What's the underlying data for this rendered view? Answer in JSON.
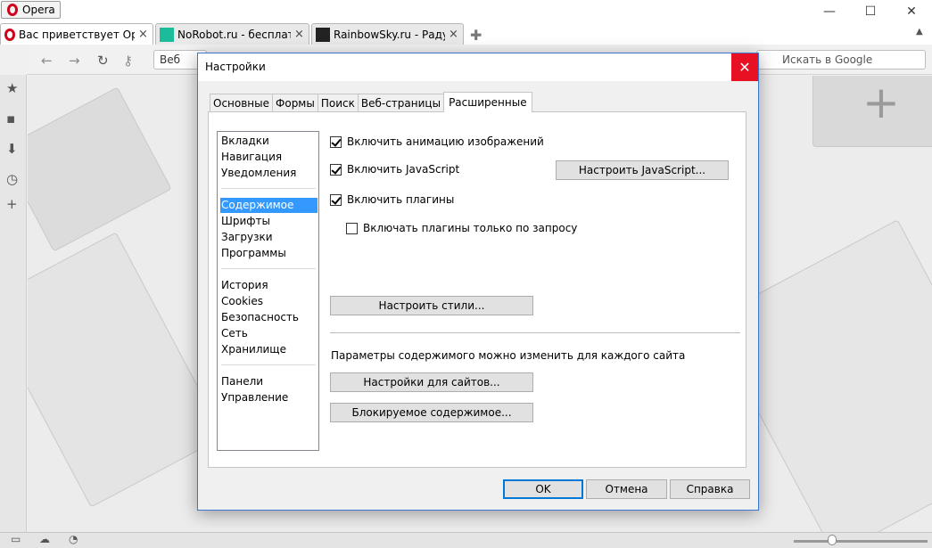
{
  "browser": {
    "menu_label": "Opera",
    "tabs": [
      {
        "title": "Вас приветствует Opera!",
        "close": "×",
        "fav_color": "#d0021b"
      },
      {
        "title": "NoRobot.ru - бесплат...",
        "close": "×",
        "fav_color": "#1abc9c"
      },
      {
        "title": "RainbowSky.ru - Радуж...",
        "close": "×",
        "fav_color": "#222222"
      }
    ],
    "address_value": "Веб",
    "search_placeholder": "Искать в Google"
  },
  "dialog": {
    "title": "Настройки",
    "close_glyph": "✕",
    "tabs": [
      "Основные",
      "Формы",
      "Поиск",
      "Веб-страницы",
      "Расширенные"
    ],
    "active_tab": "Расширенные",
    "categories": {
      "group1": [
        "Вкладки",
        "Навигация",
        "Уведомления"
      ],
      "group2": [
        "Содержимое",
        "Шрифты",
        "Загрузки",
        "Программы"
      ],
      "group3": [
        "История",
        "Cookies",
        "Безопасность",
        "Сеть",
        "Хранилище"
      ],
      "group4": [
        "Панели",
        "Управление"
      ]
    },
    "selected_category": "Содержимое",
    "options": {
      "animate_images": {
        "label": "Включить анимацию изображений",
        "checked": true
      },
      "javascript": {
        "label": "Включить JavaScript",
        "checked": true
      },
      "plugins": {
        "label": "Включить плагины",
        "checked": true
      },
      "plugins_on_demand": {
        "label": "Включать плагины только по запросу",
        "checked": false
      }
    },
    "buttons": {
      "configure_js": "Настроить JavaScript...",
      "configure_styles": "Настроить стили...",
      "site_settings": "Настройки для сайтов...",
      "blocked_content": "Блокируемое содержимое...",
      "ok": "OK",
      "cancel": "Отмена",
      "help": "Справка"
    },
    "site_note": "Параметры содержимого можно изменить для каждого сайта"
  }
}
